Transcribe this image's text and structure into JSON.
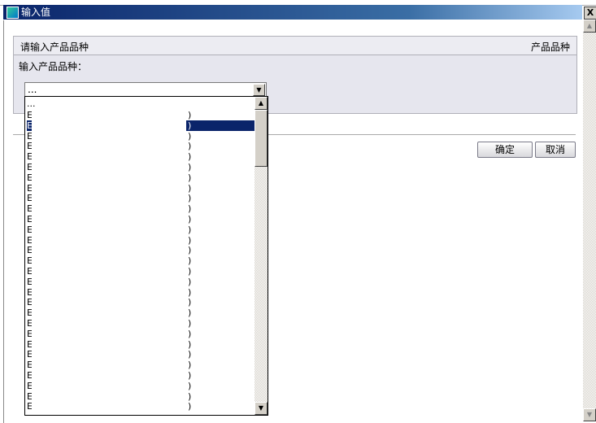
{
  "window": {
    "title": "输入值",
    "close": "X"
  },
  "panel": {
    "header_left": "请输入产品品种",
    "header_right": "产品品种",
    "label": "输入产品品种："
  },
  "combo": {
    "value": "..."
  },
  "list": {
    "first": "...",
    "items": [
      "E",
      "E",
      "E",
      "E",
      "E",
      "E",
      "E",
      "E",
      "E",
      "E",
      "E",
      "E",
      "E",
      "E",
      "E",
      "E",
      "E",
      "E",
      "E",
      "E",
      "E",
      "E",
      "E",
      "E",
      "E",
      "E",
      "E",
      "E",
      "E"
    ],
    "item_suffix": ")",
    "selected_index": 1
  },
  "buttons": {
    "ok": "确定",
    "cancel": "取消"
  }
}
